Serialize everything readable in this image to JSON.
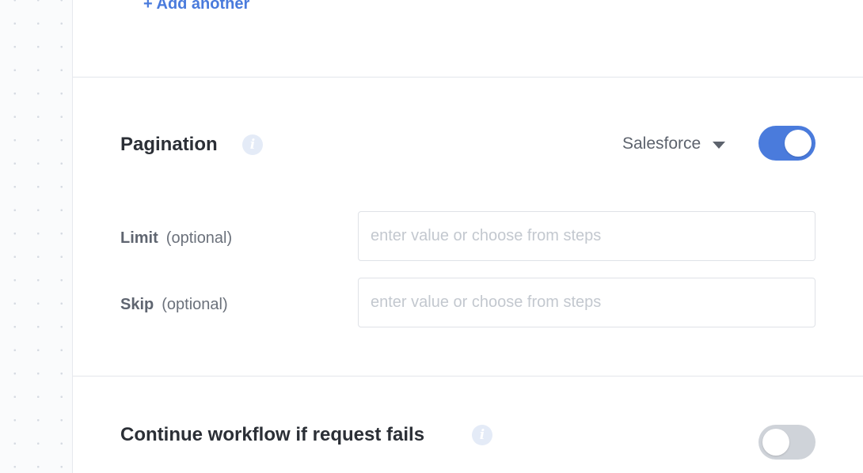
{
  "add_another": {
    "label": "+ Add another"
  },
  "pagination": {
    "title": "Pagination",
    "info_icon": "info-icon",
    "provider_dropdown": {
      "selected": "Salesforce",
      "icon": "caret-down-icon"
    },
    "enabled": true,
    "fields": [
      {
        "name": "Limit",
        "optional_label": "(optional)",
        "value": "",
        "placeholder": "enter value or choose from steps"
      },
      {
        "name": "Skip",
        "optional_label": "(optional)",
        "value": "",
        "placeholder": "enter value or choose from steps"
      }
    ]
  },
  "continue_on_failure": {
    "title": "Continue workflow if request fails",
    "info_icon": "info-icon",
    "enabled": false
  },
  "colors": {
    "accent": "#4a7bdc",
    "toggle_off": "#cfd3d9",
    "title_text": "#2b2f36",
    "muted_text": "#5d636d"
  }
}
